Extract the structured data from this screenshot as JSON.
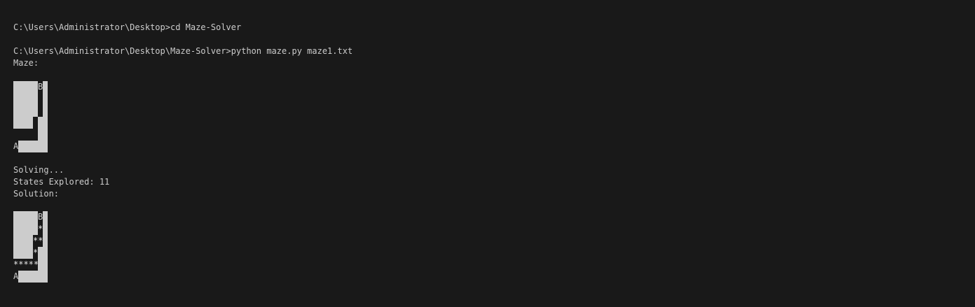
{
  "terminal": {
    "lines": [
      "C:\\Users\\Administrator\\Desktop>cd Maze-Solver",
      "C:\\Users\\Administrator\\Desktop\\Maze-Solver>python maze.py maze1.txt",
      "Maze:",
      "Solving...",
      "States Explored: 11",
      "Solution:"
    ],
    "maze": {
      "start": "A",
      "goal": "B"
    },
    "solution": {
      "start": "A",
      "goal": "B",
      "path_rows": [
        "*",
        "**",
        "*",
        "*****"
      ]
    }
  }
}
